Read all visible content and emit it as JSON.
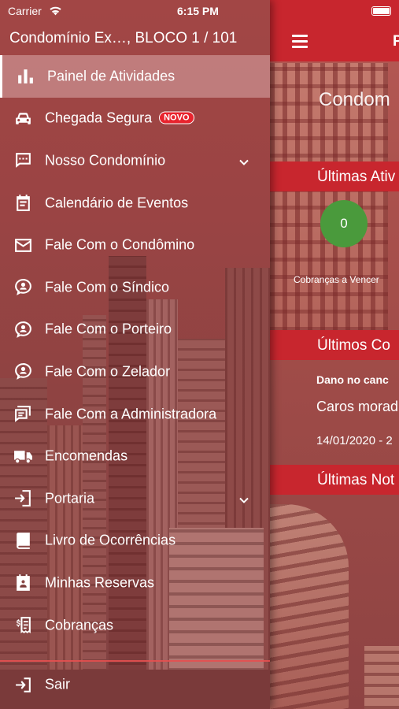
{
  "status_bar": {
    "carrier": "Carrier",
    "time": "6:15 PM"
  },
  "account_header": "Condomínio Ex…, BLOCO 1 / 101",
  "menu": [
    {
      "label": "Painel de Atividades",
      "icon": "bar-chart-icon",
      "active": true
    },
    {
      "label": "Chegada Segura",
      "icon": "car-icon",
      "badge": "NOVO"
    },
    {
      "label": "Nosso Condomínio",
      "icon": "chat-bubble-icon",
      "expandable": true
    },
    {
      "label": "Calendário de Eventos",
      "icon": "calendar-icon"
    },
    {
      "label": "Fale Com o Condômino",
      "icon": "mail-icon"
    },
    {
      "label": "Fale Com o Síndico",
      "icon": "person-bubble-icon"
    },
    {
      "label": "Fale Com o Porteiro",
      "icon": "person-bubble-icon"
    },
    {
      "label": "Fale Com o Zelador",
      "icon": "person-bubble-icon"
    },
    {
      "label": "Fale Com a Administradora",
      "icon": "forum-icon"
    },
    {
      "label": "Encomendas",
      "icon": "truck-icon"
    },
    {
      "label": "Portaria",
      "icon": "door-enter-icon",
      "expandable": true
    },
    {
      "label": "Livro de Ocorrências",
      "icon": "book-icon"
    },
    {
      "label": "Minhas Reservas",
      "icon": "reservation-icon"
    },
    {
      "label": "Cobranças",
      "icon": "receipt-icon"
    }
  ],
  "logout": {
    "label": "Sair",
    "icon": "logout-icon"
  },
  "background_screen": {
    "nav_title": "P",
    "condo_title": "Condom",
    "banner_latest_activities": "Últimas Ativ",
    "activity_count": "0",
    "activity_caption": "Cobranças a Vencer",
    "banner_latest_communications": "Últimos Co",
    "card_title": "Dano no canc",
    "card_body": "Caros morad",
    "card_date": "14/01/2020 - 2",
    "banner_latest_news": "Últimas Not"
  },
  "colors": {
    "primary": "#c8262e",
    "badge": "#e8242e",
    "success": "#4a9a3c"
  }
}
